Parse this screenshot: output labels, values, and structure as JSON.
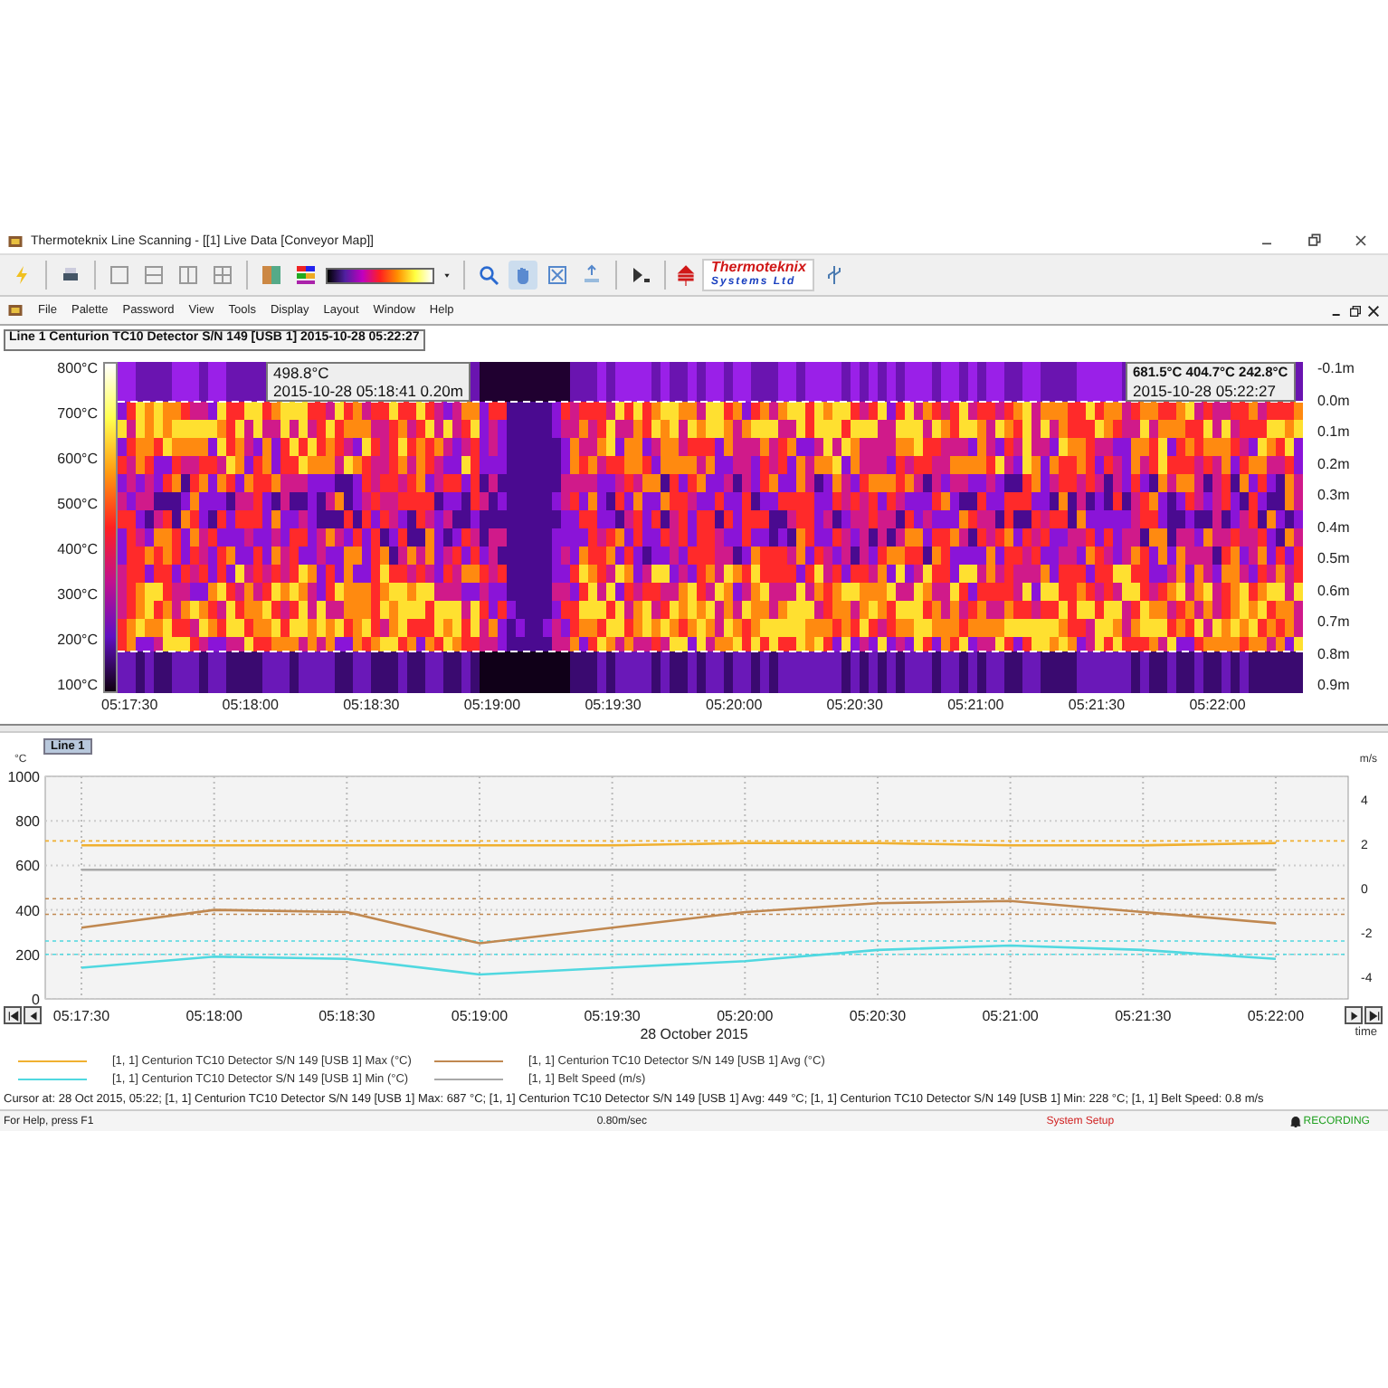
{
  "window": {
    "title": "Thermoteknix Line Scanning - [[1] Live Data [Conveyor Map]]"
  },
  "toolbar": {
    "logo": [
      "Thermoteknix",
      "Systems Ltd"
    ]
  },
  "menu": [
    "File",
    "Palette",
    "Password",
    "View",
    "Tools",
    "Display",
    "Layout",
    "Window",
    "Help"
  ],
  "map_panel": {
    "title": "Line 1 Centurion TC10 Detector S/N 149 [USB 1] 2015-10-28 05:22:27",
    "temp_labels": [
      "800°C",
      "700°C",
      "600°C",
      "500°C",
      "400°C",
      "300°C",
      "200°C",
      "100°C"
    ],
    "distance_labels": [
      "-0.1m",
      "0.0m",
      "0.1m",
      "0.2m",
      "0.3m",
      "0.4m",
      "0.5m",
      "0.6m",
      "0.7m",
      "0.8m",
      "0.9m"
    ],
    "time_labels": [
      "05:17:30",
      "05:18:00",
      "05:18:30",
      "05:19:00",
      "05:19:30",
      "05:20:00",
      "05:20:30",
      "05:21:00",
      "05:21:30",
      "05:22:00"
    ],
    "cursor_tooltip": [
      "498.8°C",
      "2015-10-28 05:18:41 0.20m"
    ],
    "live_tooltip": [
      "681.5°C 404.7°C 242.8°C",
      "2015-10-28 05:22:27"
    ]
  },
  "trend_panel": {
    "tab": {
      "label": "Line 1",
      "selected": true
    },
    "left_unit": "°C",
    "right_unit": "m/s",
    "date_label": "28 October 2015",
    "time_axis_label": "time",
    "chart_data": {
      "type": "line",
      "categories": [
        "05:17:30",
        "05:18:00",
        "05:18:30",
        "05:19:00",
        "05:19:30",
        "05:20:00",
        "05:20:30",
        "05:21:00",
        "05:21:30",
        "05:22:00"
      ],
      "ylim": [
        0,
        1000
      ],
      "yticks": [
        0,
        200,
        400,
        600,
        800,
        1000
      ],
      "y2lim": [
        -5,
        5
      ],
      "y2ticks": [
        -4,
        -2,
        0,
        2,
        4
      ],
      "series": [
        {
          "name": "[1, 1] Centurion TC10 Detector S/N 149 [USB 1] Max (°C)",
          "color": "#f0b030",
          "values": [
            690,
            690,
            690,
            690,
            690,
            700,
            700,
            690,
            690,
            700
          ]
        },
        {
          "name": "[1, 1] Centurion TC10 Detector S/N 149 [USB 1] Avg (°C)",
          "color": "#c08850",
          "values": [
            320,
            400,
            390,
            250,
            320,
            390,
            430,
            440,
            390,
            340
          ]
        },
        {
          "name": "[1, 1] Centurion TC10 Detector S/N 149 [USB 1] Min (°C)",
          "color": "#50d8e0",
          "values": [
            140,
            190,
            180,
            110,
            140,
            170,
            220,
            240,
            220,
            180
          ]
        },
        {
          "name": "[1, 1]  Belt Speed (m/s)",
          "color": "#a8a8a8",
          "axis": "y2",
          "values": [
            0.8,
            0.8,
            0.8,
            0.8,
            0.8,
            0.8,
            0.8,
            0.8,
            0.8,
            0.8
          ]
        }
      ],
      "ref_lines": [
        {
          "axis": "y",
          "value": 710,
          "color": "#f0b030"
        },
        {
          "axis": "y",
          "value": 450,
          "color": "#c08850"
        },
        {
          "axis": "y",
          "value": 380,
          "color": "#c08850"
        },
        {
          "axis": "y",
          "value": 260,
          "color": "#50d8e0"
        },
        {
          "axis": "y",
          "value": 200,
          "color": "#50d8e0"
        }
      ],
      "grid": true
    }
  },
  "cursor_info": "Cursor at: 28 Oct 2015, 05:22; [1, 1] Centurion TC10 Detector S/N 149 [USB 1] Max: 687 °C; [1, 1] Centurion TC10 Detector S/N 149 [USB 1] Avg: 449 °C; [1, 1] Centurion TC10 Detector S/N 149 [USB 1] Min: 228 °C; [1, 1]  Belt Speed: 0.8 m/s",
  "status_bar": {
    "help": "For Help, press F1",
    "speed": "0.80m/sec",
    "setup": "System Setup",
    "recording": "RECORDING"
  }
}
